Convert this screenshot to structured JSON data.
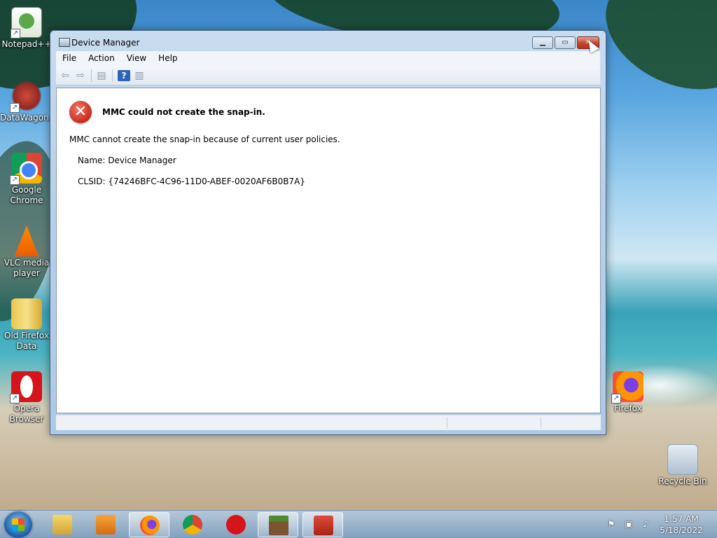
{
  "desktop": {
    "icons": [
      {
        "label": "Notepad++",
        "icon": "notepad-plus-plus-icon"
      },
      {
        "label": "DataWagon...",
        "icon": "datawagon-icon"
      },
      {
        "label": "Google Chrome",
        "icon": "chrome-icon"
      },
      {
        "label": "VLC media player",
        "icon": "vlc-icon"
      },
      {
        "label": "Old Firefox Data",
        "icon": "folder-icon"
      },
      {
        "label": "Opera Browser",
        "icon": "opera-icon"
      },
      {
        "label": "Firefox",
        "icon": "firefox-icon"
      },
      {
        "label": "Recycle Bin",
        "icon": "recycle-bin-icon"
      }
    ]
  },
  "window": {
    "title": "Device Manager",
    "controls": {
      "minimize": "▁",
      "maximize": "▭",
      "close": "✕"
    },
    "menu": [
      "File",
      "Action",
      "View",
      "Help"
    ],
    "toolbar_icons": [
      "back-arrow-icon",
      "forward-arrow-icon",
      "show-hide-console-tree-icon",
      "help-icon",
      "show-hide-action-pane-icon"
    ],
    "error": {
      "icon_glyph": "✕",
      "title": "MMC could not create the snap-in.",
      "message": "MMC cannot create the snap-in because of current user policies.",
      "name_line": "Name: Device Manager",
      "clsid_line": "CLSID: {74246BFC-4C96-11D0-ABEF-0020AF6B0B7A}"
    }
  },
  "taskbar": {
    "apps": [
      {
        "name": "Windows Explorer",
        "icon": "explorer-icon",
        "active": false
      },
      {
        "name": "Windows Media Player",
        "icon": "media-player-icon",
        "active": false
      },
      {
        "name": "Firefox",
        "icon": "firefox-icon",
        "active": true
      },
      {
        "name": "Google Chrome",
        "icon": "chrome-icon",
        "active": false
      },
      {
        "name": "Opera",
        "icon": "opera-icon",
        "active": false
      },
      {
        "name": "Minecraft",
        "icon": "minecraft-icon",
        "active": true
      },
      {
        "name": "Device Manager",
        "icon": "toolbox-icon",
        "active": true
      }
    ],
    "tray_icons": [
      "action-center-flag-icon",
      "network-icon",
      "volume-icon"
    ],
    "clock": {
      "time": "1:57 AM",
      "date": "5/18/2022"
    }
  },
  "colors": {
    "error_red": "#c62a1c",
    "close_button": "#c5452b",
    "window_frame": "#b7d0ea"
  }
}
